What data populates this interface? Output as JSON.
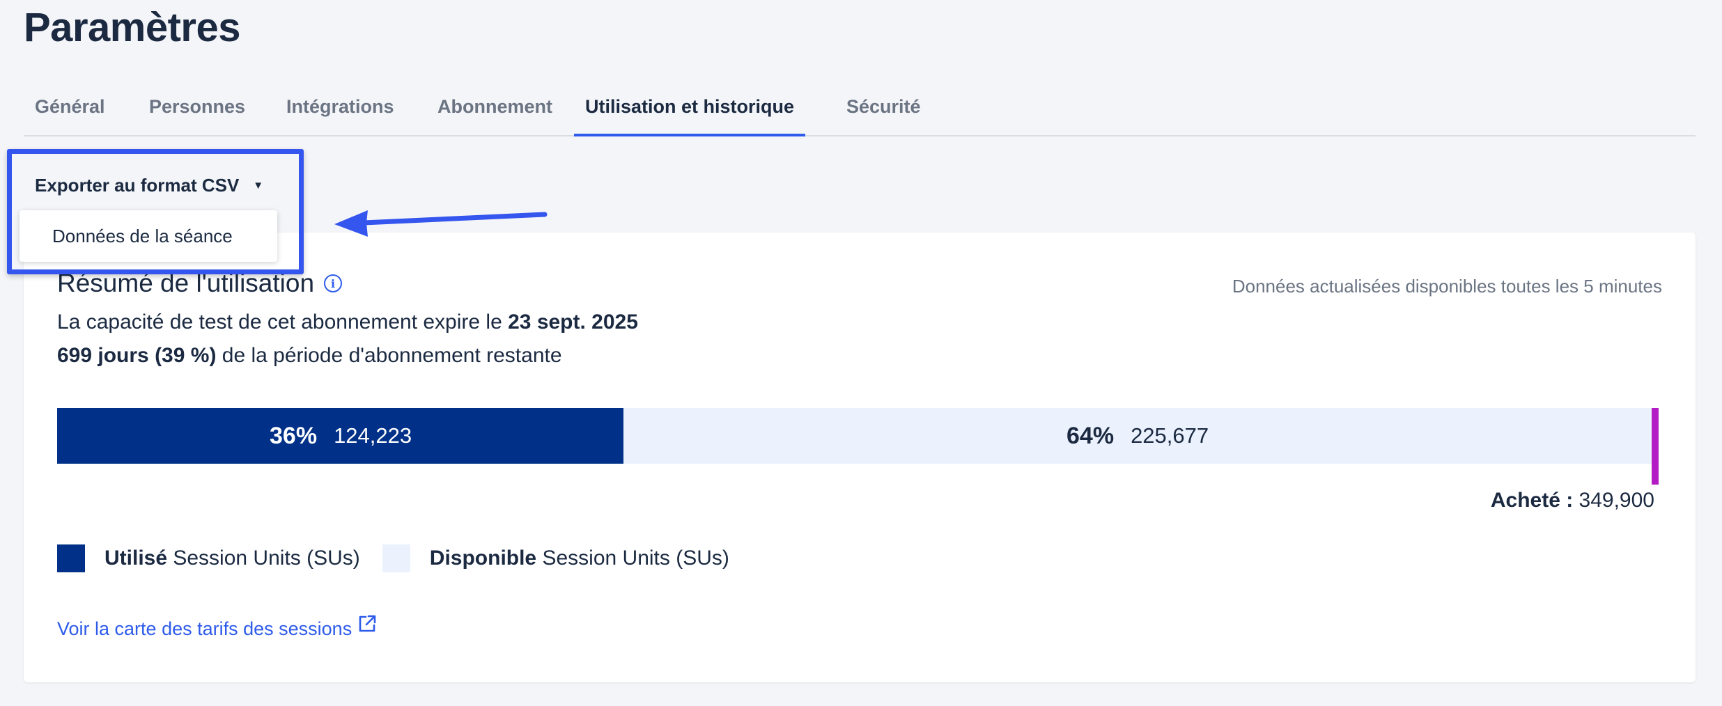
{
  "page": {
    "title": "Paramètres"
  },
  "tabs": [
    {
      "label": "Général",
      "active": false
    },
    {
      "label": "Personnes",
      "active": false
    },
    {
      "label": "Intégrations",
      "active": false
    },
    {
      "label": "Abonnement",
      "active": false
    },
    {
      "label": "Utilisation et historique",
      "active": true
    },
    {
      "label": "Sécurité",
      "active": false
    }
  ],
  "export": {
    "button_label": "Exporter au format CSV",
    "menu_items": [
      "Données de la séance"
    ]
  },
  "summary": {
    "title": "Résumé de l'utilisation",
    "refresh_note": "Données actualisées disponibles toutes les 5 minutes",
    "expiry_prefix": "La capacité de test de cet abonnement expire le ",
    "expiry_date": "23 sept. 2025",
    "remaining_bold": "699 jours (39 %)",
    "remaining_suffix": " de la période d'abonnement restante"
  },
  "usage": {
    "used_fraction": 0.355,
    "used_pct": "36%",
    "used_value": "124,223",
    "available_pct": "64%",
    "available_value": "225,677",
    "purchased_label": "Acheté :",
    "purchased_value": "349,900"
  },
  "legend": {
    "used_bold": "Utilisé",
    "used_text": " Session Units (SUs)",
    "available_bold": "Disponible",
    "available_text": " Session Units (SUs)"
  },
  "link": {
    "label": "Voir la carte des tarifs des sessions"
  },
  "colors": {
    "used": "#003087",
    "available": "#ebf1fd",
    "accent": "#2e5bea",
    "marker": "#b31bc4",
    "highlight": "#3555ef"
  }
}
